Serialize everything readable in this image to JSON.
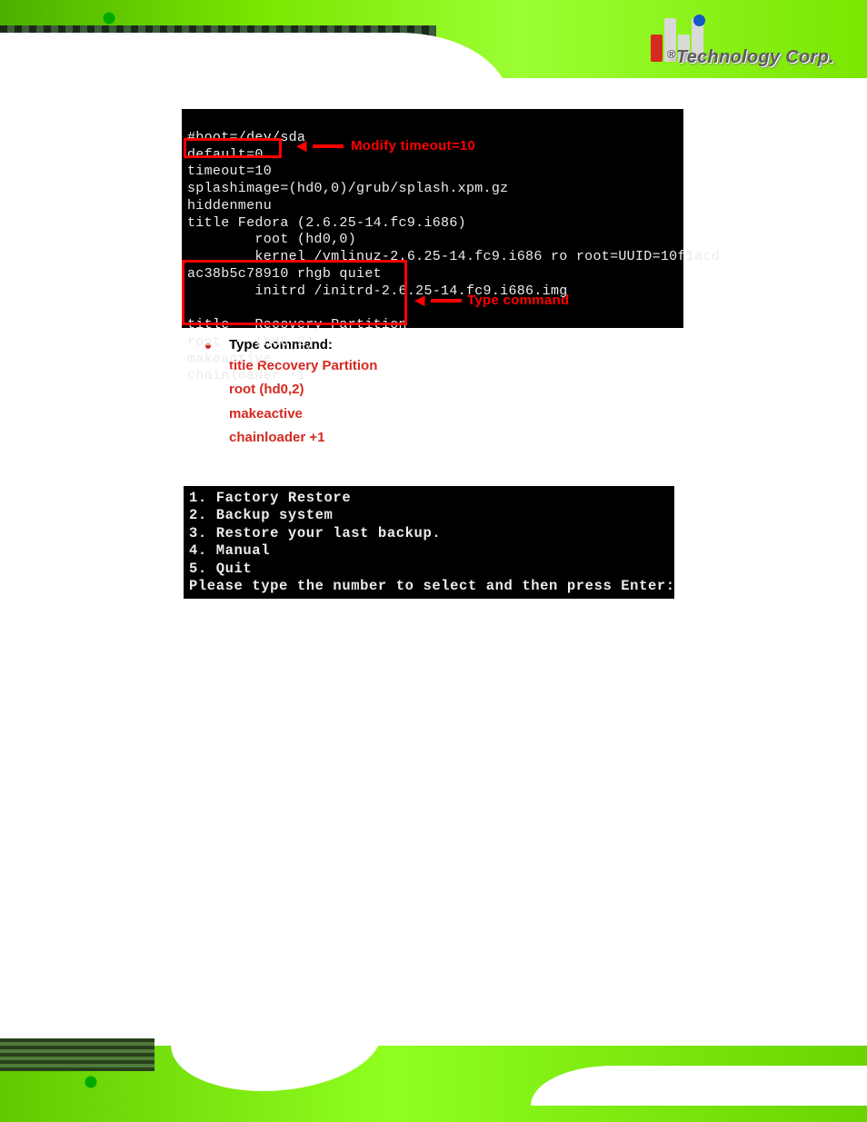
{
  "brand": {
    "registered": "®",
    "name": "Technology Corp."
  },
  "terminal1": {
    "lines_pre": "#boot=/dev/sda\ndefault=0",
    "timeout_line": "timeout=10",
    "lines_mid": "splashimage=(hd0,0)/grub/splash.xpm.gz\nhiddenmenu\ntitle Fedora (2.6.25-14.fc9.i686)\n        root (hd0,0)\n        kernel /vmlinuz-2.6.25-14.fc9.i686 ro root=UUID=10f1acd\nac38b5c78910 rhgb quiet\n        initrd /initrd-2.6.25-14.fc9.i686.img",
    "block2": "title   Recovery Partition\nroot    (hd0,2)\nmakeactive\nchainloader +1",
    "ann_modify": "Modify timeout=10",
    "ann_typecmd": "Type command"
  },
  "bullet": {
    "heading": "Type command:",
    "lines": {
      "l1": "title Recovery Partition",
      "l2": "root (hd0,2)",
      "l3": "makeactive",
      "l4": "chainloader +1"
    }
  },
  "terminal2": {
    "text": "1. Factory Restore\n2. Backup system\n3. Restore your last backup.\n4. Manual\n5. Quit\nPlease type the number to select and then press Enter:"
  }
}
